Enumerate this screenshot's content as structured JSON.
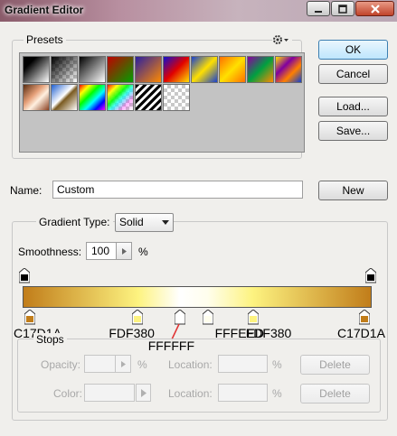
{
  "window": {
    "title": "Gradient Editor"
  },
  "presets": {
    "label": "Presets",
    "swatches": [
      {
        "name": "foreground-to-background",
        "css": "linear-gradient(135deg,#000 0%,#000 25%,#fff 100%)"
      },
      {
        "name": "foreground-to-transparent",
        "css": "checker-black"
      },
      {
        "name": "black-to-white",
        "css": "linear-gradient(135deg,#000 0%,#fff 100%)"
      },
      {
        "name": "red-green",
        "css": "linear-gradient(135deg,#c00000 0%,#00a000 100%)"
      },
      {
        "name": "violet-orange",
        "css": "linear-gradient(135deg,#2a1fa0 0%,#ff8a00 100%)"
      },
      {
        "name": "blue-red-yellow",
        "css": "linear-gradient(135deg,#1010d0 0%,#e00000 50%,#ffe000 100%)"
      },
      {
        "name": "blue-yellow-blue",
        "css": "linear-gradient(135deg,#1840d0 0%,#ffe000 50%,#1840d0 100%)"
      },
      {
        "name": "orange-yellow-orange",
        "css": "linear-gradient(135deg,#ff7000 0%,#ffe000 50%,#ff7000 100%)"
      },
      {
        "name": "violet-green-orange",
        "css": "linear-gradient(135deg,#8a00a0 0%,#00a040 50%,#ff8a00 100%)"
      },
      {
        "name": "yellow-violet-orange-blue",
        "css": "linear-gradient(135deg,#ffe000 0%,#8000a0 35%,#ff8000 65%,#1040d0 100%)"
      },
      {
        "name": "copper",
        "css": "linear-gradient(135deg,#5a2c10 0%,#e6a17a 40%,#fff0e0 60%,#8a4020 100%)"
      },
      {
        "name": "chrome",
        "css": "linear-gradient(135deg,#2060d0 0%,#ffffff 45%,#7a5a20 55%,#ffffff 100%)"
      },
      {
        "name": "spectrum",
        "css": "linear-gradient(135deg,#ff0000 0%,#ffff00 20%,#00ff00 40%,#00ffff 60%,#0000ff 80%,#ff00ff 100%)"
      },
      {
        "name": "transparent-rainbow",
        "css": "checker-rainbow"
      },
      {
        "name": "transparent-stripes",
        "css": "stripes"
      },
      {
        "name": "transparent-checker",
        "css": "checker"
      }
    ]
  },
  "buttons": {
    "ok": "OK",
    "cancel": "Cancel",
    "load": "Load...",
    "save": "Save...",
    "new": "New",
    "delete_opacity": "Delete",
    "delete_color": "Delete"
  },
  "name_field": {
    "label": "Name:",
    "value": "Custom"
  },
  "gradient": {
    "group_label": "Gradient Type:",
    "type_value": "Solid",
    "smoothness_label": "Smoothness:",
    "smoothness_value": "100",
    "smoothness_unit": "%",
    "color_stops": [
      {
        "pos": 0,
        "hex": "#C17D1A",
        "label": "C17D1A"
      },
      {
        "pos": 33,
        "hex": "#FDF380",
        "label": "FDF380"
      },
      {
        "pos": 45,
        "hex": "#FFFFFF",
        "label": "FFFFFF"
      },
      {
        "pos": 53,
        "hex": "#FFFEED",
        "label": "FFFEED"
      },
      {
        "pos": 66,
        "hex": "#FDF380",
        "label": "FDF380"
      },
      {
        "pos": 100,
        "hex": "#C17D1A",
        "label": "C17D1A"
      }
    ],
    "opacity_stops": [
      0,
      100
    ]
  },
  "stops": {
    "label": "Stops",
    "opacity_label": "Opacity:",
    "opacity_unit": "%",
    "location_label_1": "Location:",
    "location_unit_1": "%",
    "color_label": "Color:",
    "location_label_2": "Location:",
    "location_unit_2": "%"
  },
  "colors": {
    "ok_border": "#3c7fb1",
    "titlebar": "#b88fa0"
  }
}
